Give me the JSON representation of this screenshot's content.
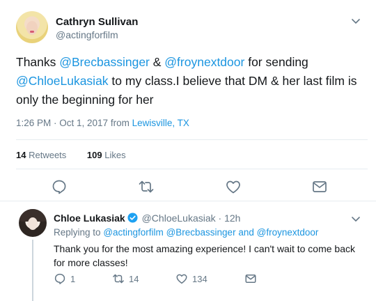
{
  "main_tweet": {
    "author_name": "Cathryn Sullivan",
    "author_handle": "@actingforfilm",
    "text_parts": [
      {
        "type": "text",
        "value": "Thanks "
      },
      {
        "type": "mention",
        "value": "@Brecbassinger"
      },
      {
        "type": "text",
        "value": " & "
      },
      {
        "type": "mention",
        "value": "@froynextdoor"
      },
      {
        "type": "text",
        "value": " for sending "
      },
      {
        "type": "mention",
        "value": "@ChloeLukasiak"
      },
      {
        "type": "text",
        "value": " to my class.I believe that DM & her last film is only the beginning for her"
      }
    ],
    "timestamp": "1:26 PM · Oct 1, 2017",
    "source_prefix": "from",
    "location": "Lewisville, TX",
    "retweets_count": "14",
    "retweets_label": "Retweets",
    "likes_count": "109",
    "likes_label": "Likes",
    "actions": [
      "reply-icon",
      "retweet-icon",
      "like-icon",
      "message-icon"
    ]
  },
  "reply_tweet": {
    "author_name": "Chloe Lukasiak",
    "author_handle": "@ChloeLukasiak",
    "separator": "·",
    "time_ago": "12h",
    "replying_prefix": "Replying to",
    "replying_to": [
      "@actingforfilm",
      "@Brecbassinger",
      "@froynextdoor"
    ],
    "replying_conjunction": "and",
    "text": "Thank you for the most amazing experience! I can't wait to come back for more classes!",
    "reply_count": "1",
    "retweet_count": "14",
    "like_count": "134"
  },
  "colors": {
    "link": "#1b95e0",
    "secondary_text": "#657786",
    "primary_text": "#14171a",
    "divider": "#e6ecf0",
    "verified": "#1da1f2"
  }
}
